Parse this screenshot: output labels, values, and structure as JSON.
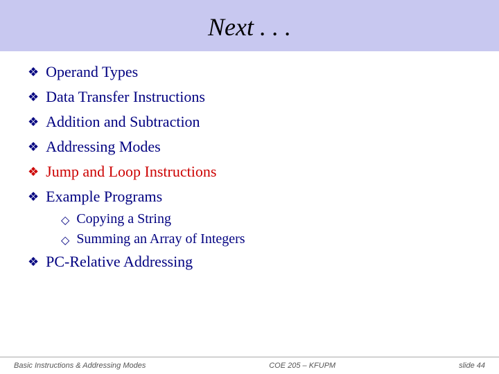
{
  "header": {
    "title": "Next . . ."
  },
  "bullets": [
    {
      "id": "operand-types",
      "symbol": "❖",
      "text": "Operand Types",
      "highlight": false,
      "sub": []
    },
    {
      "id": "data-transfer",
      "symbol": "❖",
      "text": "Data Transfer Instructions",
      "highlight": false,
      "sub": []
    },
    {
      "id": "addition",
      "symbol": "❖",
      "text": "Addition and Subtraction",
      "highlight": false,
      "sub": []
    },
    {
      "id": "addressing-modes",
      "symbol": "❖",
      "text": "Addressing Modes",
      "highlight": false,
      "sub": []
    },
    {
      "id": "jump-loop",
      "symbol": "❖",
      "text": "Jump and Loop Instructions",
      "highlight": true,
      "sub": []
    },
    {
      "id": "example-programs",
      "symbol": "❖",
      "text": "Example Programs",
      "highlight": false,
      "sub": [
        {
          "id": "copying-string",
          "symbol": "◇",
          "text": "Copying a String"
        },
        {
          "id": "summing-array",
          "symbol": "◇",
          "text": "Summing an Array of Integers"
        }
      ]
    },
    {
      "id": "pc-relative",
      "symbol": "❖",
      "text": "PC-Relative Addressing",
      "highlight": false,
      "sub": []
    }
  ],
  "footer": {
    "left": "Basic Instructions & Addressing Modes",
    "center": "COE 205 – KFUPM",
    "right": "slide 44"
  }
}
